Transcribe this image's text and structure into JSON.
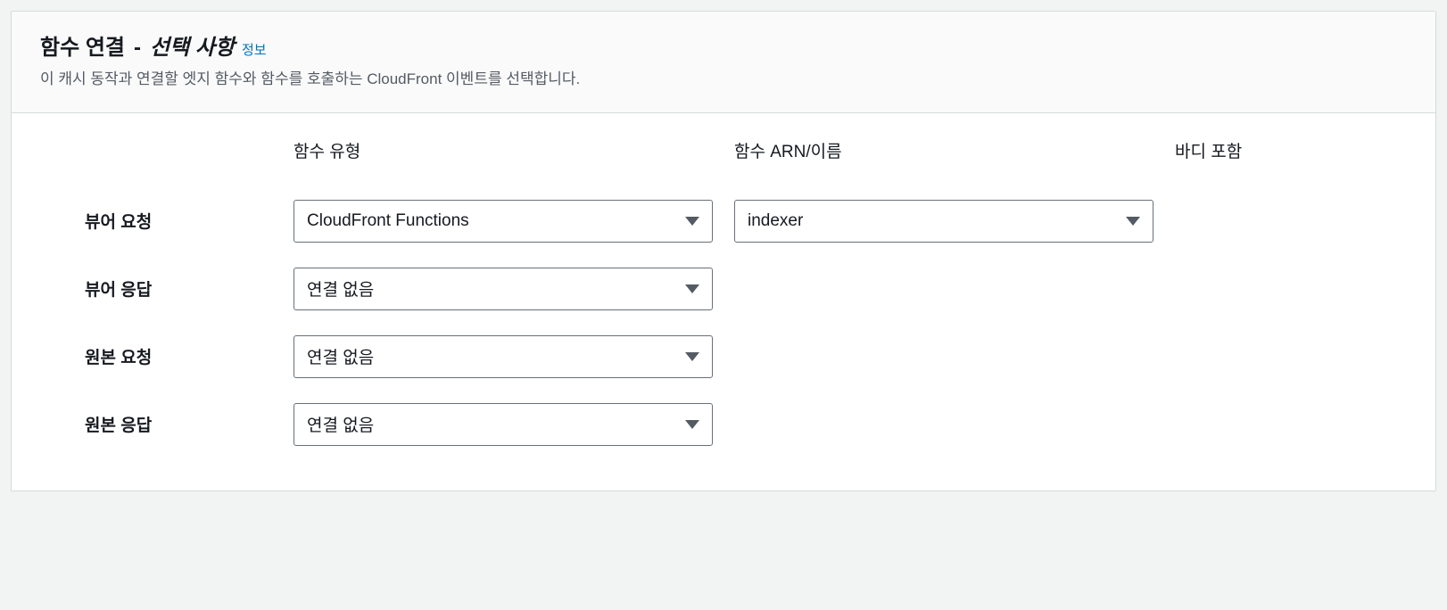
{
  "header": {
    "title": "함수 연결",
    "dash": "-",
    "optional": "선택 사항",
    "info": "정보",
    "subtitle": "이 캐시 동작과 연결할 엣지 함수와 함수를 호출하는 CloudFront 이벤트를 선택합니다."
  },
  "columns": {
    "type": "함수 유형",
    "arn": "함수 ARN/이름",
    "body": "바디 포함"
  },
  "rows": [
    {
      "label": "뷰어 요청",
      "type_value": "CloudFront Functions",
      "arn_value": "indexer",
      "show_arn": true
    },
    {
      "label": "뷰어 응답",
      "type_value": "연결 없음",
      "arn_value": "",
      "show_arn": false
    },
    {
      "label": "원본 요청",
      "type_value": "연결 없음",
      "arn_value": "",
      "show_arn": false
    },
    {
      "label": "원본 응답",
      "type_value": "연결 없음",
      "arn_value": "",
      "show_arn": false
    }
  ]
}
